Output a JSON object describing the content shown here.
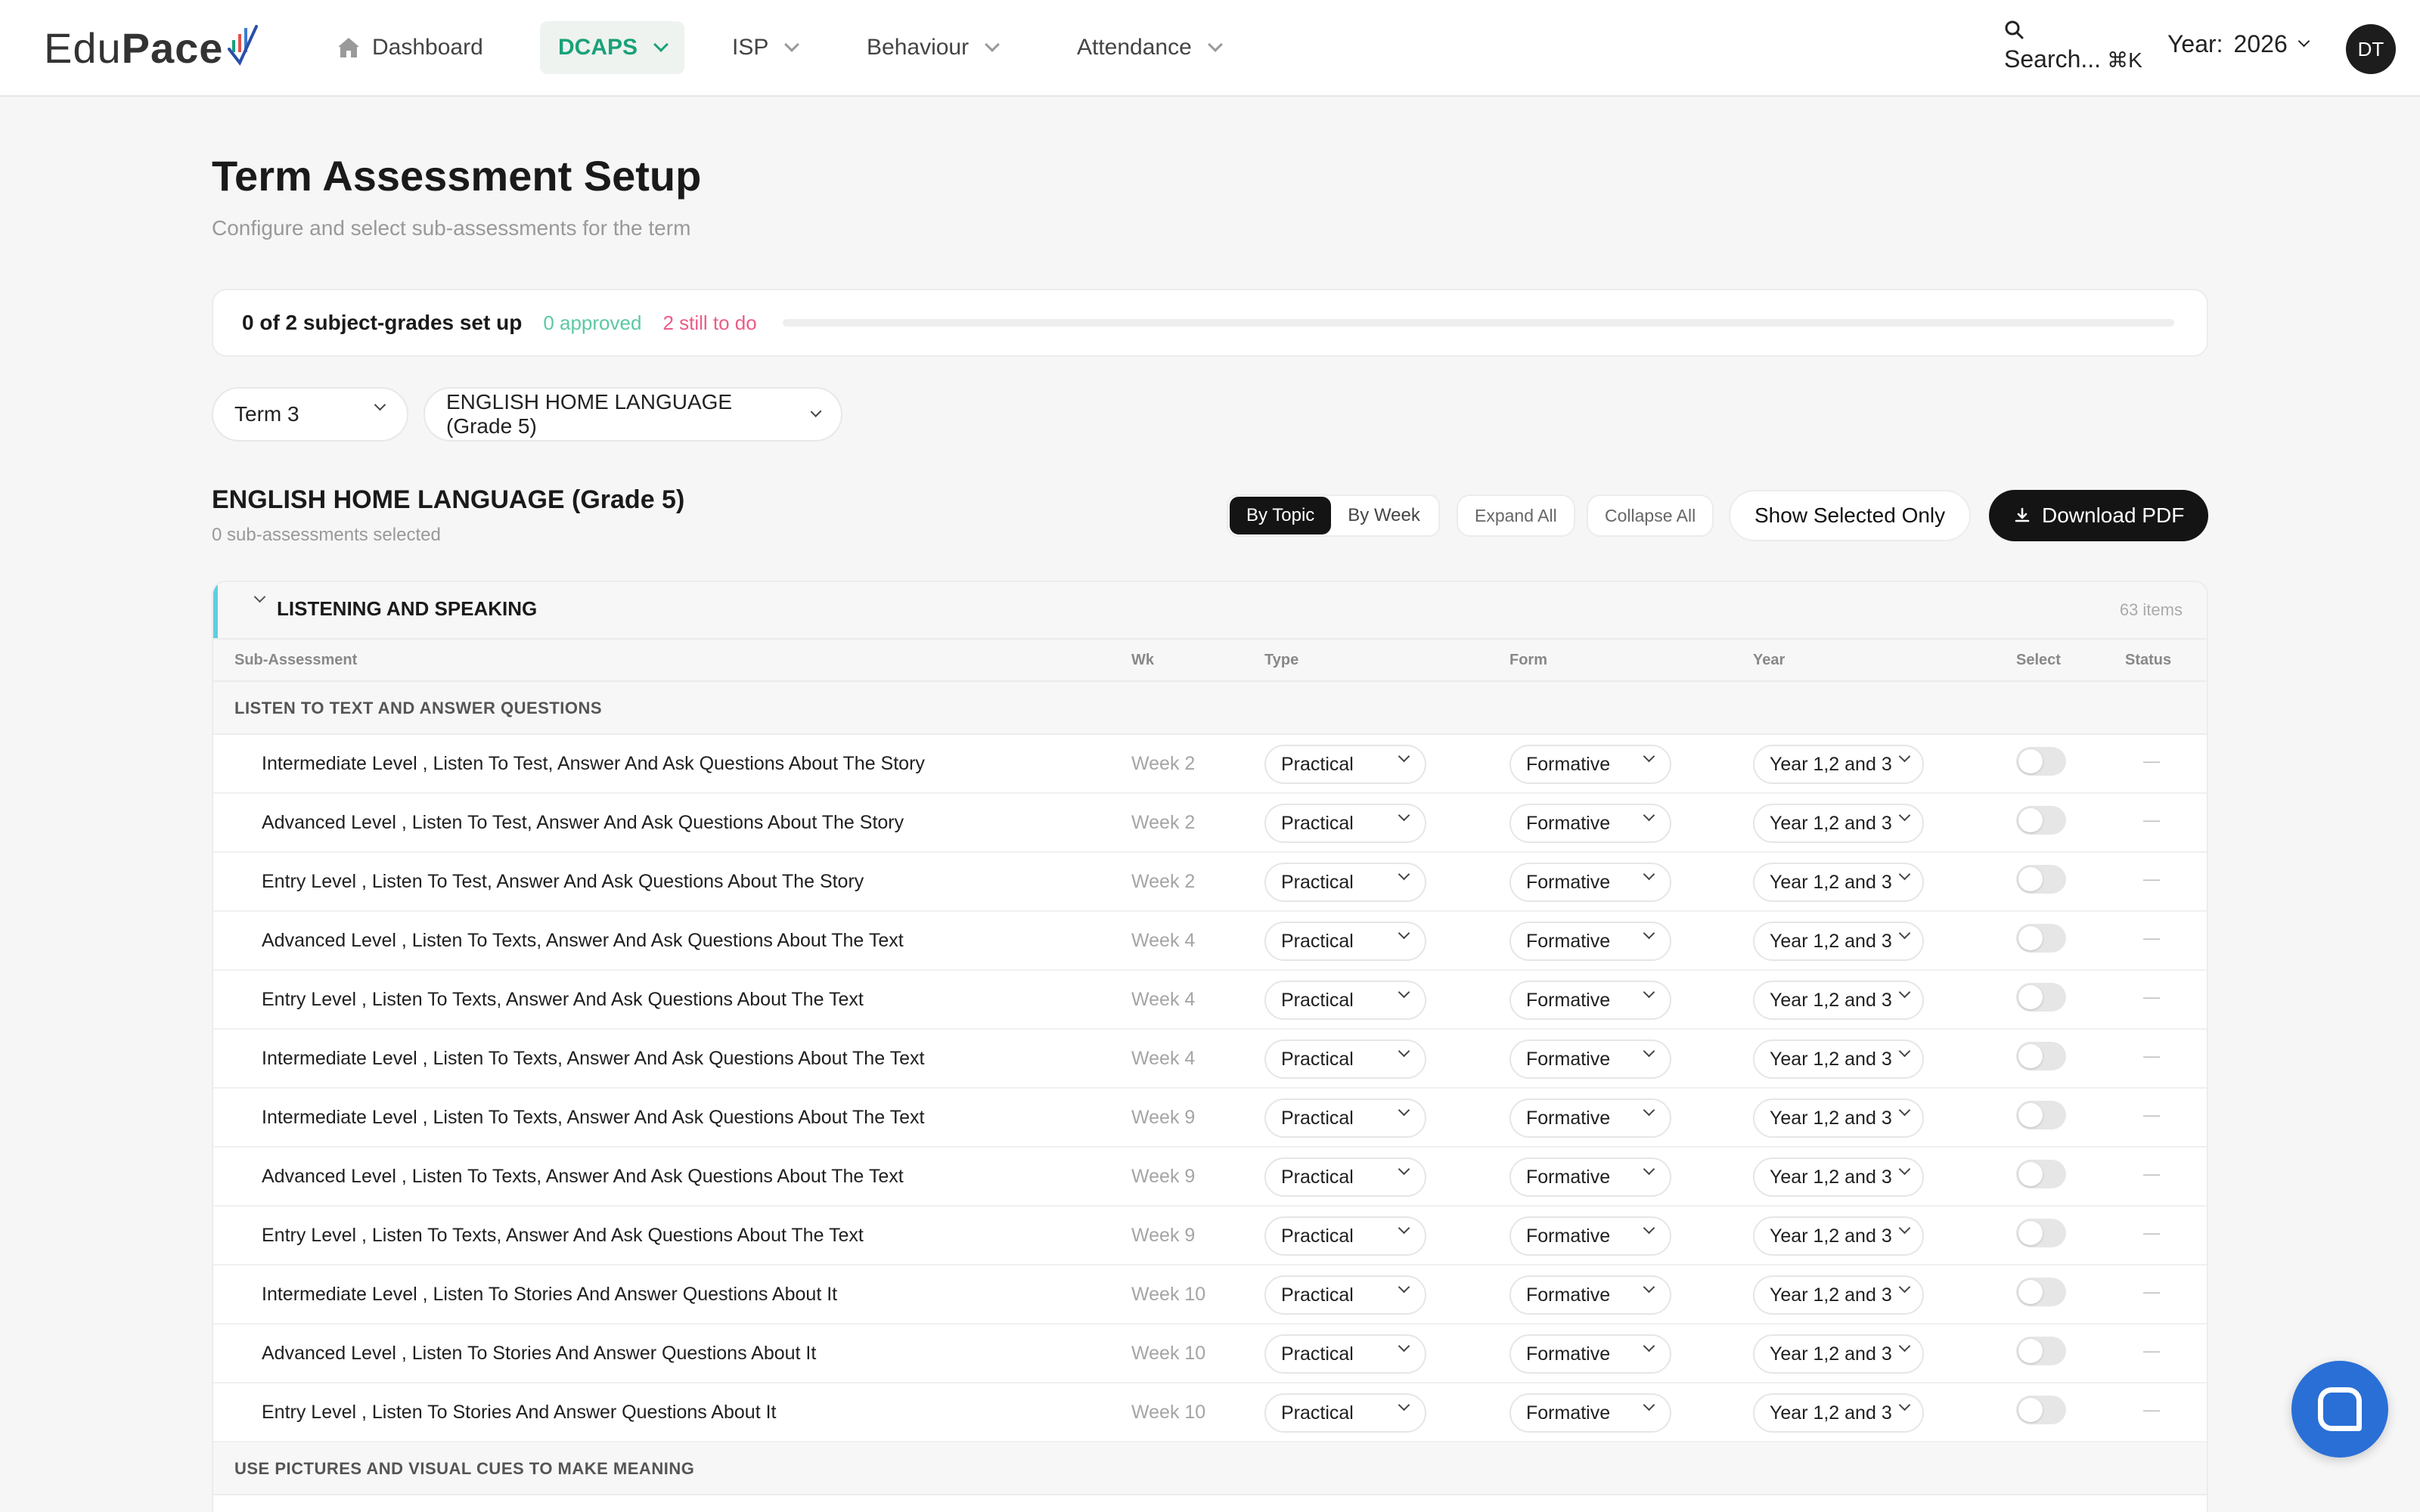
{
  "brand": {
    "name_light": "Edu",
    "name_bold": "Pace"
  },
  "nav": {
    "items": [
      {
        "label": "Dashboard"
      },
      {
        "label": "DCAPS"
      },
      {
        "label": "ISP"
      },
      {
        "label": "Behaviour"
      },
      {
        "label": "Attendance"
      }
    ],
    "search": {
      "label": "Search...",
      "shortcut": "⌘K"
    },
    "year": {
      "label": "Year:",
      "value": "2026"
    },
    "user_initials": "DT"
  },
  "page": {
    "title": "Term Assessment Setup",
    "subtitle": "Configure and select sub-assessments for the term"
  },
  "progress": {
    "summary": "0 of 2 subject-grades set up",
    "approved": "0 approved",
    "todo": "2 still to do",
    "fraction": 0
  },
  "filters": {
    "term": "Term 3",
    "subject": "ENGLISH HOME LANGUAGE (Grade 5)"
  },
  "subject": {
    "title": "ENGLISH HOME LANGUAGE (Grade 5)",
    "selected_count": "0 sub-assessments selected"
  },
  "toolbar": {
    "by_topic": "By Topic",
    "by_week": "By Week",
    "expand_all": "Expand All",
    "collapse_all": "Collapse All",
    "show_selected": "Show Selected Only",
    "download_pdf": "Download PDF"
  },
  "table": {
    "section": {
      "title": "LISTENING AND SPEAKING",
      "count": "63 items"
    },
    "columns": {
      "sub_assessment": "Sub-Assessment",
      "wk": "Wk",
      "type": "Type",
      "form": "Form",
      "year": "Year",
      "select": "Select",
      "status": "Status"
    },
    "group1": "LISTEN TO TEXT AND ANSWER QUESTIONS",
    "group2": "USE PICTURES AND VISUAL CUES TO MAKE MEANING",
    "rows": [
      {
        "name": "Intermediate Level , Listen To Test, Answer And Ask Questions About The Story",
        "week": "Week 2",
        "type": "Practical",
        "form": "Formative",
        "year": "Year 1,2 and 3",
        "status": "—"
      },
      {
        "name": "Advanced Level , Listen To Test, Answer And Ask Questions About The Story",
        "week": "Week 2",
        "type": "Practical",
        "form": "Formative",
        "year": "Year 1,2 and 3",
        "status": "—"
      },
      {
        "name": "Entry Level , Listen To Test, Answer And Ask Questions About The Story",
        "week": "Week 2",
        "type": "Practical",
        "form": "Formative",
        "year": "Year 1,2 and 3",
        "status": "—"
      },
      {
        "name": "Advanced Level , Listen To Texts, Answer And Ask Questions About The Text",
        "week": "Week 4",
        "type": "Practical",
        "form": "Formative",
        "year": "Year 1,2 and 3",
        "status": "—"
      },
      {
        "name": "Entry Level , Listen To Texts, Answer And Ask Questions About The Text",
        "week": "Week 4",
        "type": "Practical",
        "form": "Formative",
        "year": "Year 1,2 and 3",
        "status": "—"
      },
      {
        "name": "Intermediate Level , Listen To Texts, Answer And Ask Questions About The Text",
        "week": "Week 4",
        "type": "Practical",
        "form": "Formative",
        "year": "Year 1,2 and 3",
        "status": "—"
      },
      {
        "name": "Intermediate Level , Listen To Texts, Answer And Ask Questions About The Text",
        "week": "Week 9",
        "type": "Practical",
        "form": "Formative",
        "year": "Year 1,2 and 3",
        "status": "—"
      },
      {
        "name": "Advanced Level , Listen To Texts, Answer And Ask Questions About The Text",
        "week": "Week 9",
        "type": "Practical",
        "form": "Formative",
        "year": "Year 1,2 and 3",
        "status": "—"
      },
      {
        "name": "Entry Level , Listen To Texts, Answer And Ask Questions About The Text",
        "week": "Week 9",
        "type": "Practical",
        "form": "Formative",
        "year": "Year 1,2 and 3",
        "status": "—"
      },
      {
        "name": "Intermediate Level , Listen To Stories And Answer Questions About It",
        "week": "Week 10",
        "type": "Practical",
        "form": "Formative",
        "year": "Year 1,2 and 3",
        "status": "—"
      },
      {
        "name": "Advanced Level , Listen To Stories And Answer Questions About It",
        "week": "Week 10",
        "type": "Practical",
        "form": "Formative",
        "year": "Year 1,2 and 3",
        "status": "—"
      },
      {
        "name": "Entry Level , Listen To Stories And Answer Questions About It",
        "week": "Week 10",
        "type": "Practical",
        "form": "Formative",
        "year": "Year 1,2 and 3",
        "status": "—"
      }
    ]
  },
  "colors": {
    "accent_green": "#1aa17a",
    "approved": "#5cc8a4",
    "todo": "#ec5c86",
    "section_accent": "#5fcfe0",
    "chat_button": "#2a6fd6"
  }
}
